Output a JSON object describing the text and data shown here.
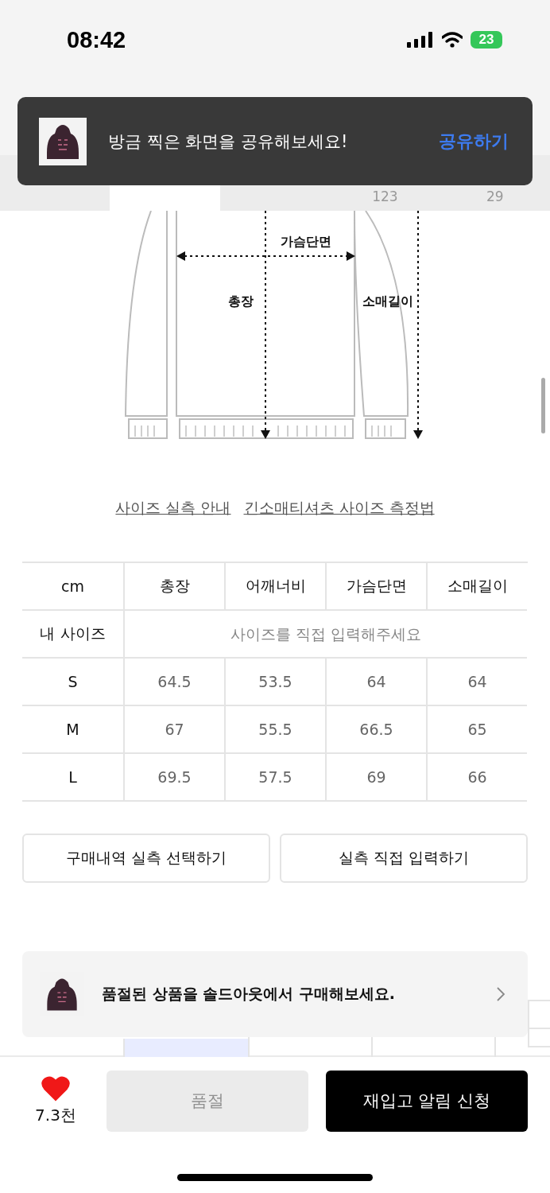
{
  "status_bar": {
    "time": "08:42",
    "battery": "23"
  },
  "tabs": [
    {
      "selected": false
    },
    {
      "selected": true
    },
    {
      "selected": false
    },
    {
      "count": "123",
      "selected": false
    },
    {
      "count": "29",
      "selected": false
    }
  ],
  "toast": {
    "message": "방금 찍은 화면을 공유해보세요!",
    "action": "공유하기"
  },
  "diagram": {
    "labels": [
      {
        "kind": "chest",
        "text": "가슴단면"
      },
      {
        "kind": "length",
        "text": "총장"
      },
      {
        "kind": "sleeve",
        "text": "소매길이"
      }
    ]
  },
  "guide_links": [
    "사이즈 실측 안내",
    "긴소매티셔츠 사이즈 측정법"
  ],
  "size_table": {
    "columns": [
      "cm",
      "총장",
      "어깨너비",
      "가슴단면",
      "소매길이"
    ],
    "my_size": {
      "label": "내 사이즈",
      "placeholder": "사이즈를 직접 입력해주세요"
    },
    "rows": [
      [
        "S",
        "64.5",
        "53.5",
        "64",
        "64"
      ],
      [
        "M",
        "67",
        "55.5",
        "66.5",
        "65"
      ],
      [
        "L",
        "69.5",
        "57.5",
        "69",
        "66"
      ]
    ]
  },
  "actions": [
    "구매내역 실측 선택하기",
    "실측 직접 입력하기"
  ],
  "soldout_banner": {
    "text": "품절된 상품을 솔드아웃에서 구매해보세요."
  },
  "bottom_bar": {
    "likes": "7.3천",
    "liked": true,
    "soldout_button": {
      "label": "품절",
      "disabled": true
    },
    "restock_button": {
      "label": "재입고 알림 신청"
    }
  }
}
